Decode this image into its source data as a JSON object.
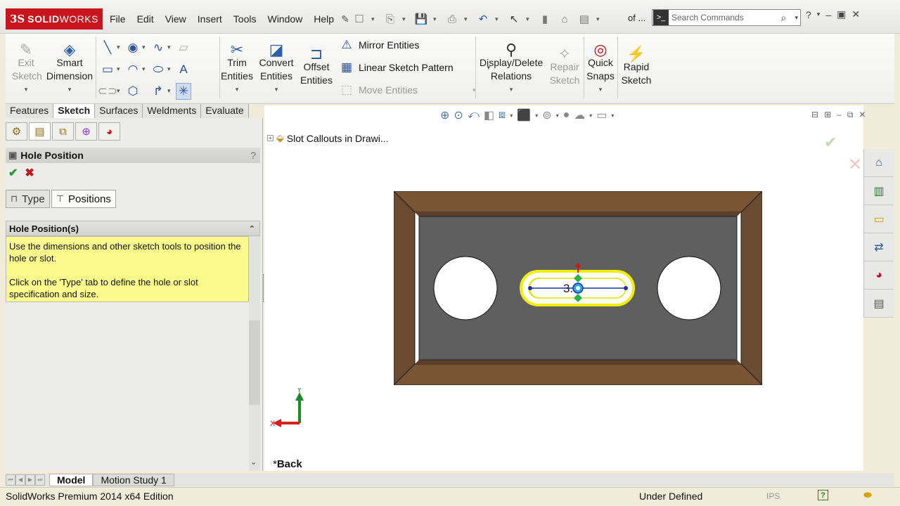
{
  "app": {
    "logo_ds": "3S",
    "logo_text_bold": "SOLID",
    "logo_text_light": "WORKS",
    "menu": [
      "File",
      "Edit",
      "View",
      "Insert",
      "Tools",
      "Window",
      "Help"
    ],
    "of_label": "of ...",
    "search_placeholder": "Search Commands"
  },
  "command_manager": {
    "exit_sketch": "Exit Sketch",
    "smart_dimension": "Smart Dimension",
    "trim_entities": "Trim Entities",
    "convert_entities": "Convert Entities",
    "offset_entities": "Offset Entities",
    "mirror_entities": "Mirror Entities",
    "linear_sketch_pattern": "Linear Sketch Pattern",
    "move_entities": "Move Entities",
    "display_delete_relations": "Display/Delete Relations",
    "repair_sketch": "Repair Sketch",
    "quick_snaps": "Quick Snaps",
    "rapid_sketch": "Rapid Sketch"
  },
  "cmd_tabs": [
    "Features",
    "Sketch",
    "Surfaces",
    "Weldments",
    "Evaluate"
  ],
  "active_cmd_tab": "Sketch",
  "property_manager": {
    "title": "Hole Position",
    "help": "?",
    "tabs": [
      "Type",
      "Positions"
    ],
    "active_tab": "Positions",
    "group_title": "Hole Position(s)",
    "message_1": "Use the dimensions and other sketch tools to position the hole or slot.",
    "message_2": "Click on the 'Type' tab to define the hole or slot specification and size."
  },
  "graphics": {
    "tree_item": "Slot Callouts in Drawi...",
    "view_name_star": "*",
    "view_name": "Back",
    "dimension_text": "3.0",
    "axis_x": "X",
    "axis_y": "Y"
  },
  "model_tabs": [
    "Model",
    "Motion Study 1"
  ],
  "active_model_tab": "Model",
  "status": {
    "edition": "SolidWorks Premium 2014 x64 Edition",
    "state": "Under Defined",
    "units": "IPS"
  },
  "colors": {
    "brand": "#c9141d",
    "part_frame": "#6b4a2f",
    "part_face": "#5f5f5f",
    "slot_highlight": "#f2ee00",
    "sketch_blue": "#1d2ea8",
    "message_bg": "#fbfb8c",
    "confirm_green": "#1f9c2c",
    "cancel_red": "#c3121b"
  }
}
